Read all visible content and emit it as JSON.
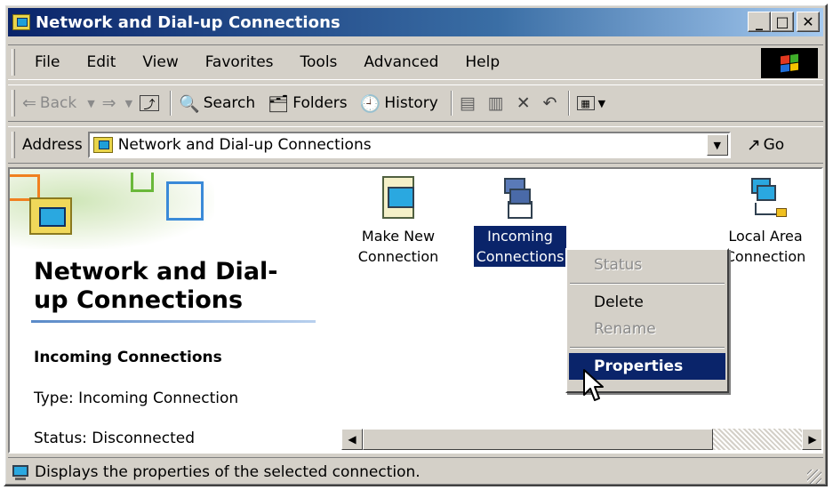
{
  "window": {
    "title": "Network and Dial-up Connections"
  },
  "caption_buttons": {
    "minimize": "_",
    "maximize": "□",
    "close": "✕"
  },
  "menu": {
    "items": [
      {
        "label": "File"
      },
      {
        "label": "Edit"
      },
      {
        "label": "View"
      },
      {
        "label": "Favorites"
      },
      {
        "label": "Tools"
      },
      {
        "label": "Advanced"
      },
      {
        "label": "Help"
      }
    ]
  },
  "toolbar": {
    "back_label": "Back",
    "search_label": "Search",
    "folders_label": "Folders",
    "history_label": "History"
  },
  "address": {
    "label": "Address",
    "value": "Network and Dial-up Connections",
    "go_label": "Go"
  },
  "webview": {
    "title": "Network and Dial-up Connections",
    "selected_name": "Incoming Connections",
    "type_text": "Type: Incoming Connection",
    "status_text": "Status: Disconnected"
  },
  "icons": [
    {
      "label_line1": "Make New",
      "label_line2": "Connection"
    },
    {
      "label_line1": "Incoming",
      "label_line2": "Connections",
      "selected": true
    },
    {
      "label_line1": "Local Area",
      "label_line2": "Connection"
    }
  ],
  "context_menu": {
    "items": [
      {
        "label": "Status",
        "state": "disabled"
      },
      {
        "label": "Delete",
        "state": "enabled"
      },
      {
        "label": "Rename",
        "state": "disabled"
      },
      {
        "label": "Properties",
        "state": "highlighted"
      }
    ]
  },
  "statusbar": {
    "text": "Displays the properties of the selected connection."
  },
  "colors": {
    "face": "#d4d0c8",
    "selection": "#0a246a",
    "title_start": "#0a246a",
    "title_end": "#a6caf0"
  }
}
